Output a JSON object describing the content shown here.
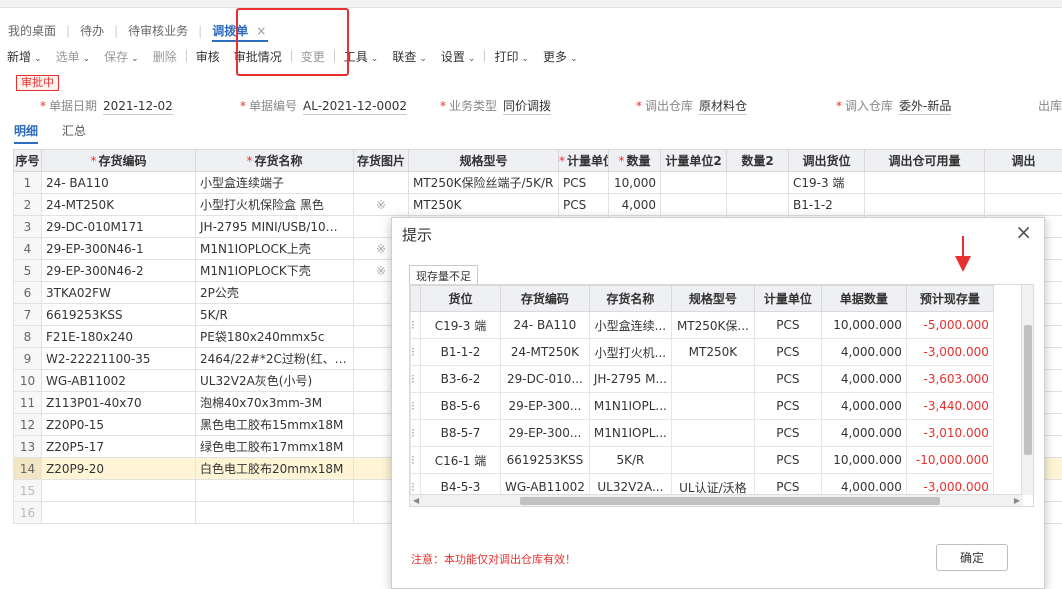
{
  "tabs": [
    {
      "label": "我的桌面"
    },
    {
      "label": "待办"
    },
    {
      "label": "待审核业务"
    },
    {
      "label": "调拨单"
    }
  ],
  "toolbar": [
    {
      "label": "新增",
      "caret": true,
      "disabled": false
    },
    {
      "label": "选单",
      "caret": true,
      "disabled": true
    },
    {
      "label": "保存",
      "caret": true,
      "disabled": true
    },
    {
      "label": "删除",
      "caret": false,
      "disabled": true
    },
    {
      "label": "审核",
      "caret": false,
      "disabled": false,
      "sepBefore": true
    },
    {
      "label": "审批情况",
      "caret": false,
      "disabled": false
    },
    {
      "label": "变更",
      "caret": false,
      "disabled": true,
      "sepBefore": true
    },
    {
      "label": "工具",
      "caret": true,
      "disabled": false,
      "sepBefore": true
    },
    {
      "label": "联查",
      "caret": true,
      "disabled": false
    },
    {
      "label": "设置",
      "caret": true,
      "disabled": false
    },
    {
      "label": "打印",
      "caret": true,
      "disabled": false,
      "sepBefore": true
    },
    {
      "label": "更多",
      "caret": true,
      "disabled": false
    }
  ],
  "status": "审批中",
  "form": {
    "date_label": "单据日期",
    "date_value": "2021-12-02",
    "no_label": "单据编号",
    "no_value": "AL-2021-12-0002",
    "biz_label": "业务类型",
    "biz_value": "同价调拨",
    "out_label": "调出仓库",
    "out_value": "原材料仓",
    "in_label": "调入仓库",
    "in_value": "委外-新品",
    "more_label": "出库"
  },
  "subtabs": [
    "明细",
    "汇总"
  ],
  "grid": {
    "headers": [
      "序号",
      "存货编码",
      "存货名称",
      "存货图片",
      "规格型号",
      "计量单位",
      "数量",
      "计量单位2",
      "数量2",
      "调出货位",
      "调出仓可用量",
      "调出"
    ],
    "required": [
      false,
      true,
      true,
      false,
      false,
      true,
      true,
      false,
      false,
      false,
      false,
      false
    ],
    "rows": [
      {
        "no": "1",
        "code": "24- BA110",
        "name": "小型盒连续端子",
        "img": "",
        "spec": "MT250K保险丝端子/5K/R",
        "unit": "PCS",
        "qty": "10,000",
        "loc": "C19-3 端"
      },
      {
        "no": "2",
        "code": "24-MT250K",
        "name": "小型打火机保险盒 黑色",
        "img": "※",
        "spec": "MT250K",
        "unit": "PCS",
        "qty": "4,000",
        "loc": "B1-1-2"
      },
      {
        "no": "3",
        "code": "29-DC-010M171",
        "name": "JH-2795 MINI/USB/10短...",
        "img": "",
        "spec": "",
        "unit": "",
        "qty": "",
        "loc": ""
      },
      {
        "no": "4",
        "code": "29-EP-300N46-1",
        "name": "M1N1IOPLOCK上壳",
        "img": "※",
        "spec": "",
        "unit": "",
        "qty": "",
        "loc": ""
      },
      {
        "no": "5",
        "code": "29-EP-300N46-2",
        "name": "M1N1IOPLOCK下壳",
        "img": "※",
        "spec": "",
        "unit": "",
        "qty": "",
        "loc": ""
      },
      {
        "no": "6",
        "code": "3TKA02FW",
        "name": "2P公壳",
        "img": "",
        "spec": "",
        "unit": "",
        "qty": "",
        "loc": ""
      },
      {
        "no": "7",
        "code": "6619253KSS",
        "name": "5K/R",
        "img": "",
        "spec": "",
        "unit": "",
        "qty": "",
        "loc": ""
      },
      {
        "no": "8",
        "code": "F21E-180x240",
        "name": "PE袋180x240mmx5c",
        "img": "",
        "spec": "",
        "unit": "",
        "qty": "",
        "loc": ""
      },
      {
        "no": "9",
        "code": "W2-22221100-35",
        "name": "2464/22#*2C过粉(红、黑...",
        "img": "",
        "spec": "",
        "unit": "",
        "qty": "",
        "loc": ""
      },
      {
        "no": "10",
        "code": "WG-AB11002",
        "name": "UL32V2A灰色(小号)",
        "img": "",
        "spec": "",
        "unit": "",
        "qty": "",
        "loc": ""
      },
      {
        "no": "11",
        "code": "Z113P01-40x70",
        "name": "泡棉40x70x3mm-3M",
        "img": "",
        "spec": "",
        "unit": "",
        "qty": "",
        "loc": ""
      },
      {
        "no": "12",
        "code": "Z20P0-15",
        "name": "黑色电工胶布15mmx18M",
        "img": "",
        "spec": "",
        "unit": "",
        "qty": "",
        "loc": ""
      },
      {
        "no": "13",
        "code": "Z20P5-17",
        "name": "绿色电工胶布17mmx18M",
        "img": "",
        "spec": "",
        "unit": "",
        "qty": "",
        "loc": ""
      },
      {
        "no": "14",
        "code": "Z20P9-20",
        "name": "白色电工胶布20mmx18M",
        "img": "",
        "spec": "",
        "unit": "",
        "qty": "",
        "loc": ""
      },
      {
        "no": "15",
        "code": "",
        "name": "",
        "img": "",
        "spec": "",
        "unit": "",
        "qty": "",
        "loc": ""
      },
      {
        "no": "16",
        "code": "",
        "name": "",
        "img": "",
        "spec": "",
        "unit": "",
        "qty": "",
        "loc": ""
      }
    ]
  },
  "dialog": {
    "title": "提示",
    "close": "×",
    "tab": "现存量不足",
    "headers": [
      "货位",
      "存货编码",
      "存货名称",
      "规格型号",
      "计量单位",
      "单据数量",
      "预计现存量"
    ],
    "rows": [
      {
        "loc": "C19-3 端",
        "code": "24- BA110",
        "name": "小型盒连续...",
        "spec": "MT250K保...",
        "unit": "PCS",
        "qty": "10,000.000",
        "est": "-5,000.000"
      },
      {
        "loc": "B1-1-2",
        "code": "24-MT250K",
        "name": "小型打火机...",
        "spec": "MT250K",
        "unit": "PCS",
        "qty": "4,000.000",
        "est": "-3,000.000"
      },
      {
        "loc": "B3-6-2",
        "code": "29-DC-010...",
        "name": "JH-2795 M...",
        "spec": "",
        "unit": "PCS",
        "qty": "4,000.000",
        "est": "-3,603.000"
      },
      {
        "loc": "B8-5-6",
        "code": "29-EP-300...",
        "name": "M1N1IOPL...",
        "spec": "",
        "unit": "PCS",
        "qty": "4,000.000",
        "est": "-3,440.000"
      },
      {
        "loc": "B8-5-7",
        "code": "29-EP-300...",
        "name": "M1N1IOPL...",
        "spec": "",
        "unit": "PCS",
        "qty": "4,000.000",
        "est": "-3,010.000"
      },
      {
        "loc": "C16-1 端",
        "code": "6619253KSS",
        "name": "5K/R",
        "spec": "",
        "unit": "PCS",
        "qty": "10,000.000",
        "est": "-10,000.000"
      },
      {
        "loc": "B4-5-3",
        "code": "WG-AB11002",
        "name": "UL32V2A...",
        "spec": "UL认证/沃格",
        "unit": "PCS",
        "qty": "4,000.000",
        "est": "-3,000.000"
      }
    ],
    "note": "注意：本功能仅对调出仓库有效！",
    "ok": "确定"
  },
  "colors": {
    "accent": "#2d6cc0",
    "alert": "#e8302f"
  }
}
